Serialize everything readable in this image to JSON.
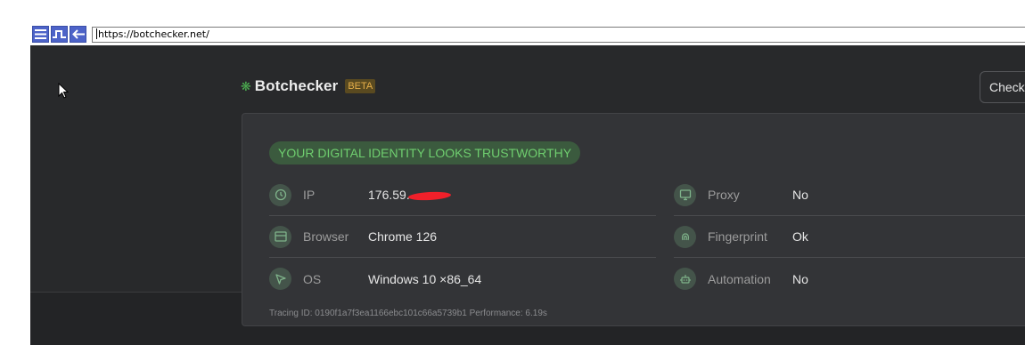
{
  "browser": {
    "url": "https://botchecker.net/",
    "buttons": [
      "menu-icon",
      "pulse-icon",
      "back-arrow-icon"
    ]
  },
  "header": {
    "brand_icon": "❋",
    "brand_name": "Botchecker",
    "badge": "BETA",
    "check_button": "Check"
  },
  "card": {
    "status": "YOUR DIGITAL IDENTITY LOOKS TRUSTWORTHY",
    "left_rows": [
      {
        "icon": "clock-icon",
        "label": "IP",
        "value": "176.59.",
        "redacted": true
      },
      {
        "icon": "browser-window-icon",
        "label": "Browser",
        "value": "Chrome 126"
      },
      {
        "icon": "cursor-arrow-icon",
        "label": "OS",
        "value": "Windows 10 ×86_64"
      }
    ],
    "right_rows": [
      {
        "icon": "monitor-icon",
        "label": "Proxy",
        "value": "No"
      },
      {
        "icon": "fingerprint-icon",
        "label": "Fingerprint",
        "value": "Ok"
      },
      {
        "icon": "robot-icon",
        "label": "Automation",
        "value": "No"
      }
    ],
    "trace": "Tracing ID: 0190f1a7f3ea1166ebc101c66a5739b1 Performance: 6.19s"
  },
  "colors": {
    "page_bg": "#28292b",
    "card_bg": "#333437",
    "success": "#6fce6f",
    "beta": "#e8b04a",
    "redaction": "#f0202a"
  }
}
